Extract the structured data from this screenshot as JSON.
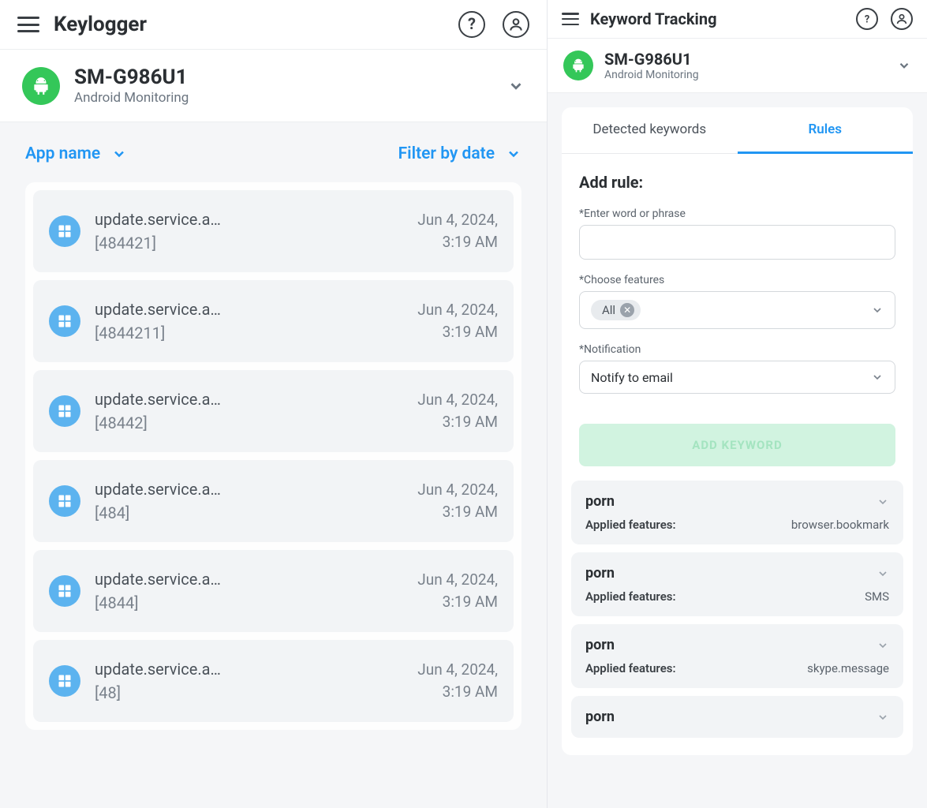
{
  "left": {
    "title": "Keylogger",
    "device": {
      "name": "SM-G986U1",
      "sub": "Android Monitoring"
    },
    "filters": {
      "app": "App name",
      "date": "Filter by date"
    },
    "logs": [
      {
        "app": "update.service.a…",
        "code": "[484421]",
        "date": "Jun 4, 2024,",
        "time": "3:19 AM"
      },
      {
        "app": "update.service.a…",
        "code": "[4844211]",
        "date": "Jun 4, 2024,",
        "time": "3:19 AM"
      },
      {
        "app": "update.service.a…",
        "code": "[48442]",
        "date": "Jun 4, 2024,",
        "time": "3:19 AM"
      },
      {
        "app": "update.service.a…",
        "code": "[484]",
        "date": "Jun 4, 2024,",
        "time": "3:19 AM"
      },
      {
        "app": "update.service.a…",
        "code": "[4844]",
        "date": "Jun 4, 2024,",
        "time": "3:19 AM"
      },
      {
        "app": "update.service.a…",
        "code": "[48]",
        "date": "Jun 4, 2024,",
        "time": "3:19 AM"
      }
    ]
  },
  "right": {
    "title": "Keyword Tracking",
    "device": {
      "name": "SM-G986U1",
      "sub": "Android Monitoring"
    },
    "tabs": {
      "detected": "Detected keywords",
      "rules": "Rules"
    },
    "form": {
      "title": "Add rule:",
      "word_label": "*Enter word or phrase",
      "features_label": "*Choose features",
      "chip_all": "All",
      "notif_label": "*Notification",
      "notif_value": "Notify to email",
      "submit": "ADD KEYWORD"
    },
    "rules": [
      {
        "keyword": "porn",
        "label": "Applied features:",
        "value": "browser.bookmark",
        "partial": false
      },
      {
        "keyword": "porn",
        "label": "Applied features:",
        "value": "SMS",
        "partial": false
      },
      {
        "keyword": "porn",
        "label": "Applied features:",
        "value": "skype.message",
        "partial": false
      },
      {
        "keyword": "porn",
        "label": "Applied features:",
        "value": "",
        "partial": true
      }
    ]
  }
}
